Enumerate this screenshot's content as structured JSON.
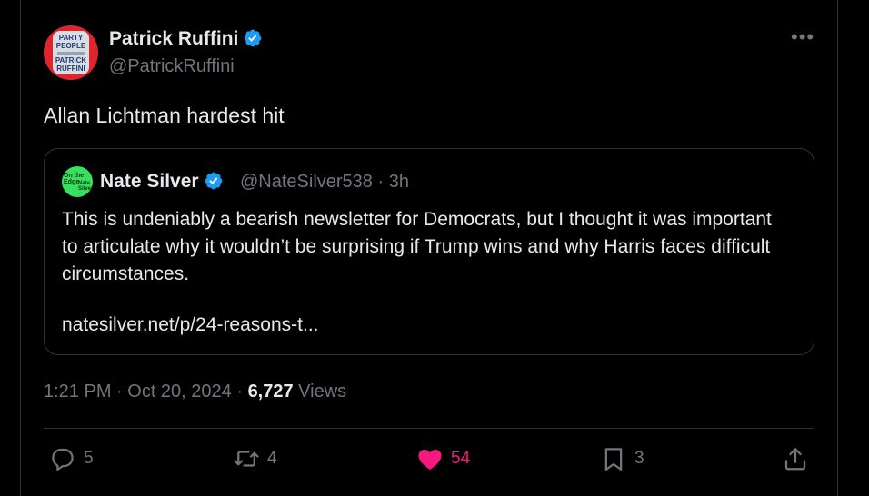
{
  "author": {
    "name": "Patrick Ruffini",
    "handle": "@PatrickRuffini",
    "avatar_lines": [
      "PARTY",
      "PEOPLE",
      "PATRICK",
      "RUFFINI"
    ]
  },
  "tweet": {
    "text": "Allan Lichtman hardest hit",
    "timestamp": "1:21 PM · Oct 20, 2024 · ",
    "views_count": "6,727",
    "views_label": " Views"
  },
  "quote": {
    "name": "Nate Silver",
    "handle_time": "@NateSilver538 · 3h",
    "avatar_text": [
      "On the Edge",
      "Nate Silver"
    ],
    "text": "This is undeniably a bearish newsletter for Democrats, but I thought it was important to articulate why it wouldn’t be surprising if Trump wins and why Harris faces difficult circumstances.",
    "link": "natesilver.net/p/24-reasons-t..."
  },
  "actions": {
    "replies": "5",
    "retweets": "4",
    "likes": "54",
    "bookmarks": "3"
  },
  "colors": {
    "background": "#000000",
    "text": "#e7e9ea",
    "muted": "#71767b",
    "verified": "#1d9bf0",
    "like": "#f91880",
    "border": "#2f3336"
  },
  "icons": [
    "verified-badge-icon",
    "more-icon",
    "reply-icon",
    "retweet-icon",
    "heart-icon",
    "bookmark-icon",
    "share-icon"
  ]
}
